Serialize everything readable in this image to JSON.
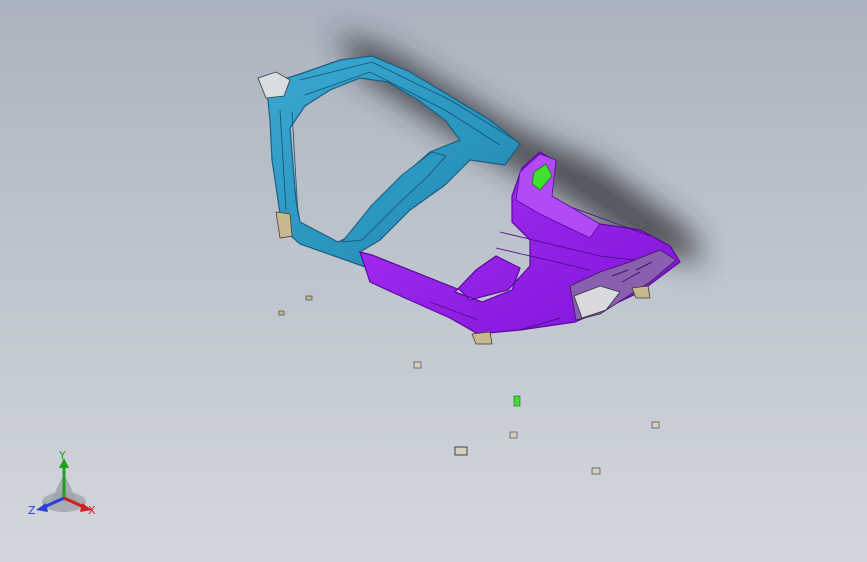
{
  "viewport": {
    "background_top": "#aab3bf",
    "background_bottom": "#d3d7dd"
  },
  "model": {
    "frame_color": "#2e9ec8",
    "frame_edge_color": "#1c5f7e",
    "panel_color": "#9a1ff0",
    "panel_edge_color": "#5b0a9a",
    "bracket_color": "#3fe02f",
    "small_part_color": "#c8b890"
  },
  "triad": {
    "x_label": "X",
    "y_label": "Y",
    "z_label": "Z",
    "x_color": "#d22020",
    "y_color": "#1fa01f",
    "z_color": "#2a3fd8"
  }
}
